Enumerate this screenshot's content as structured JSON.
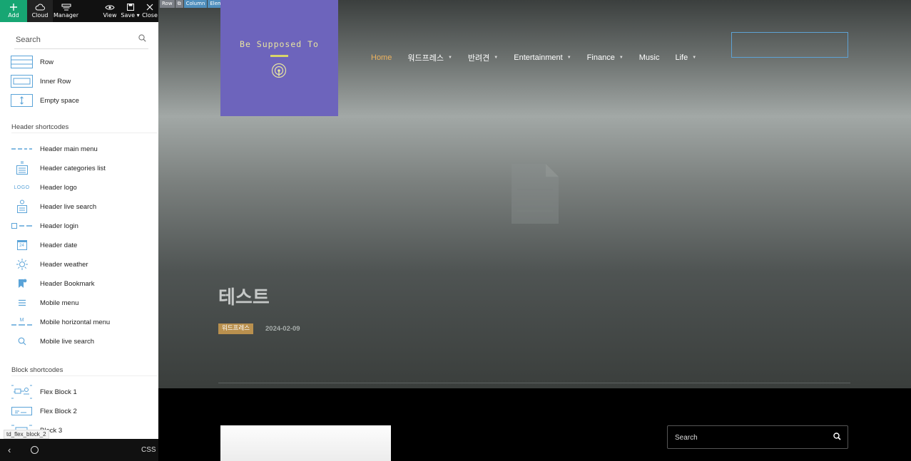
{
  "toolbar": {
    "add": "Add",
    "cloud": "Cloud",
    "manager": "Manager",
    "view": "View",
    "save": "Save ▾",
    "close": "Close"
  },
  "panel": {
    "search_placeholder": "Search",
    "basic_items": [
      {
        "label": "Row",
        "icon": "row-icon"
      },
      {
        "label": "Inner Row",
        "icon": "inner-row-icon"
      },
      {
        "label": "Empty space",
        "icon": "empty-space-icon"
      }
    ],
    "header_section": "Header shortcodes",
    "header_items": [
      {
        "label": "Header main menu",
        "icon": "main-menu-icon"
      },
      {
        "label": "Header categories list",
        "icon": "categories-list-icon"
      },
      {
        "label": "Header logo",
        "icon": "logo-icon"
      },
      {
        "label": "Header live search",
        "icon": "live-search-icon"
      },
      {
        "label": "Header login",
        "icon": "login-icon"
      },
      {
        "label": "Header date",
        "icon": "calendar-icon"
      },
      {
        "label": "Header weather",
        "icon": "sun-icon"
      },
      {
        "label": "Header Bookmark",
        "icon": "bookmark-icon"
      },
      {
        "label": "Mobile menu",
        "icon": "hamburger-icon"
      },
      {
        "label": "Mobile horizontal menu",
        "icon": "horizontal-menu-icon"
      },
      {
        "label": "Mobile live search",
        "icon": "search-icon"
      }
    ],
    "logo_icon_text": "LOGO",
    "date_icon_text": "24",
    "horizontal_icon_text": "M",
    "block_section": "Block shortcodes",
    "block_items": [
      {
        "label": "Flex Block 1",
        "icon": "flex-block-1-icon"
      },
      {
        "label": "Flex Block 2",
        "icon": "flex-block-2-icon"
      },
      {
        "label": "Block 3",
        "icon": "flex-block-3-icon"
      }
    ],
    "tooltip": "td_flex_block_2"
  },
  "bottombar": {
    "back": "‹",
    "css": "CSS"
  },
  "canvas": {
    "crumbs": [
      "Row",
      "Column",
      "Element"
    ],
    "logo_text": "Be Supposed To",
    "nav": [
      {
        "label": "Home",
        "active": true,
        "caret": false
      },
      {
        "label": "워드프레스",
        "active": false,
        "caret": true
      },
      {
        "label": "반려견",
        "active": false,
        "caret": true
      },
      {
        "label": "Entertainment",
        "active": false,
        "caret": true
      },
      {
        "label": "Finance",
        "active": false,
        "caret": true
      },
      {
        "label": "Music",
        "active": false,
        "caret": false
      },
      {
        "label": "Life",
        "active": false,
        "caret": true
      }
    ],
    "cta_label": "",
    "post_title": "테스트",
    "post_category": "워드프레스",
    "post_date": "2024-02-09",
    "footer_fragment": "",
    "search_placeholder": "Search"
  },
  "colors": {
    "accent_green": "#17a673",
    "nav_active": "#ecb25f",
    "logo_bg": "#6d64bc",
    "logo_text": "#e8e5a0",
    "category_badge": "#b9904e",
    "icon_blue": "#5aa3d8",
    "cta_border": "#5ea2d4"
  }
}
